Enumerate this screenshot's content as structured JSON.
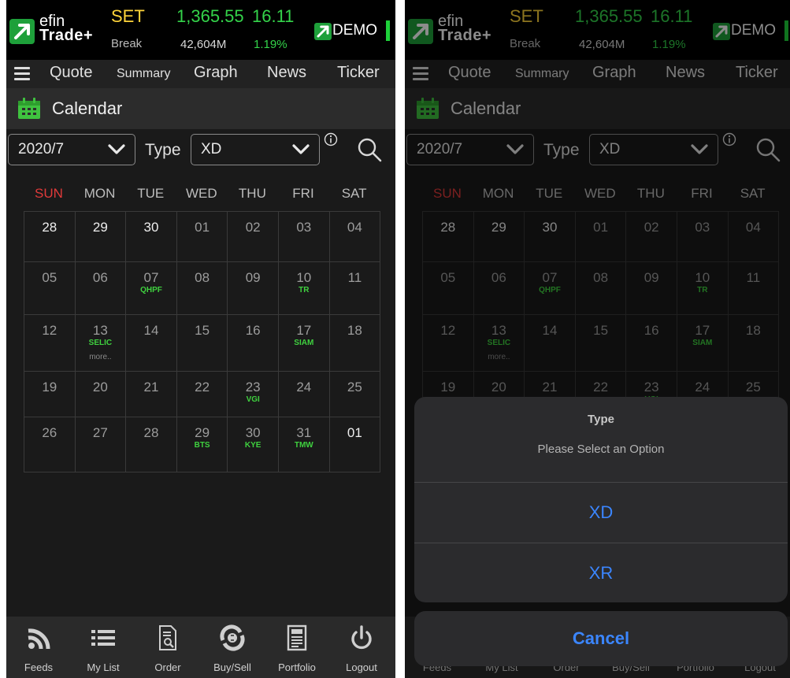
{
  "header": {
    "logo_efin": "efin",
    "logo_trade": "Trade+",
    "market": "SET",
    "status": "Break",
    "index": "1,365.55",
    "change": "16.11",
    "volume": "42,604M",
    "change_pct": "1.19%",
    "mode": "DEMO"
  },
  "nav": {
    "items": [
      {
        "label": "Quote"
      },
      {
        "label": "Summary"
      },
      {
        "label": "Graph"
      },
      {
        "label": "News"
      },
      {
        "label": "Ticker"
      }
    ]
  },
  "page": {
    "title": "Calendar"
  },
  "filter": {
    "month_value": "2020/7",
    "type_label": "Type",
    "type_value": "XD"
  },
  "calendar": {
    "days": [
      "SUN",
      "MON",
      "TUE",
      "WED",
      "THU",
      "FRI",
      "SAT"
    ],
    "weeks": [
      [
        {
          "d": "28",
          "b": true
        },
        {
          "d": "29",
          "b": true
        },
        {
          "d": "30",
          "b": true
        },
        {
          "d": "01"
        },
        {
          "d": "02"
        },
        {
          "d": "03"
        },
        {
          "d": "04"
        }
      ],
      [
        {
          "d": "05"
        },
        {
          "d": "06"
        },
        {
          "d": "07",
          "e": "QHPF"
        },
        {
          "d": "08"
        },
        {
          "d": "09"
        },
        {
          "d": "10",
          "e": "TR"
        },
        {
          "d": "11"
        }
      ],
      [
        {
          "d": "12"
        },
        {
          "d": "13",
          "e": "SELIC",
          "more": "more.."
        },
        {
          "d": "14"
        },
        {
          "d": "15"
        },
        {
          "d": "16"
        },
        {
          "d": "17",
          "e": "SIAM"
        },
        {
          "d": "18"
        }
      ],
      [
        {
          "d": "19"
        },
        {
          "d": "20"
        },
        {
          "d": "21"
        },
        {
          "d": "22"
        },
        {
          "d": "23",
          "e": "VGI"
        },
        {
          "d": "24"
        },
        {
          "d": "25"
        }
      ],
      [
        {
          "d": "26"
        },
        {
          "d": "27"
        },
        {
          "d": "28"
        },
        {
          "d": "29",
          "e": "BTS"
        },
        {
          "d": "30",
          "e": "KYE"
        },
        {
          "d": "31",
          "e": "TMW"
        },
        {
          "d": "01",
          "b": true
        }
      ]
    ]
  },
  "tabbar": {
    "items": [
      {
        "label": "Feeds",
        "icon": "rss-icon"
      },
      {
        "label": "My List",
        "icon": "list-icon"
      },
      {
        "label": "Order",
        "icon": "document-search-icon"
      },
      {
        "label": "Buy/Sell",
        "icon": "coin-exchange-icon"
      },
      {
        "label": "Portfolio",
        "icon": "portfolio-icon"
      },
      {
        "label": "Logout",
        "icon": "power-icon"
      }
    ]
  },
  "picker": {
    "title": "Type",
    "message": "Please Select an Option",
    "options": [
      "XD",
      "XR"
    ],
    "cancel": "Cancel"
  },
  "colors": {
    "accent_green": "#34d34a",
    "market_yellow": "#ffd43a",
    "sunday_red": "#e03a3a",
    "ios_blue": "#3b86ff"
  }
}
